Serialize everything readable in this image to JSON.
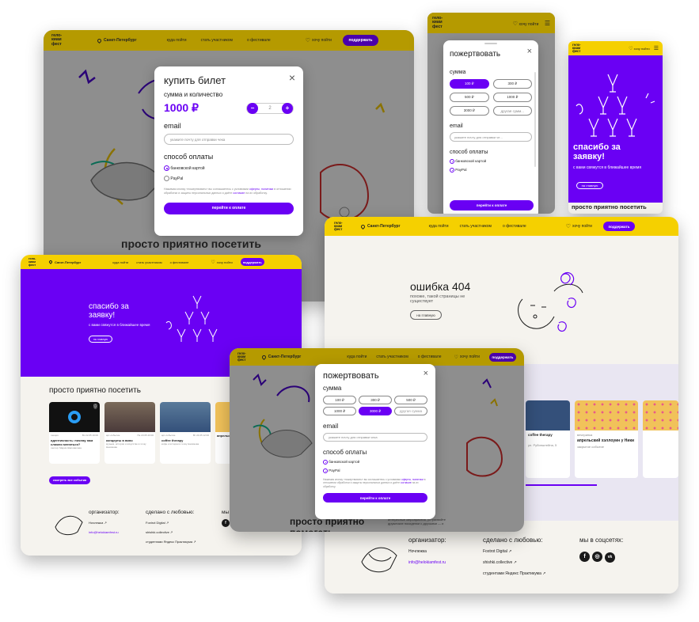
{
  "brand": {
    "logo": "гело-\nкиам\nфест",
    "city": "Санкт-Петербург"
  },
  "colors": {
    "accent": "#6a00f4",
    "brand": "#f5d000",
    "background": "#f5f3ee"
  },
  "nav": {
    "where": "куда пойти",
    "participate": "стать участником",
    "about": "о фестивале",
    "want": "хочу пойти",
    "support": "поддержать"
  },
  "ticket_modal": {
    "title": "купить билет",
    "subtitle": "сумма и количество",
    "price": "1000 ₽",
    "quantity": "2",
    "email_label": "email",
    "email_placeholder": "укажите почту для отправки чека",
    "payment_label": "способ оплаты",
    "methods": [
      "банковской картой",
      "PayPal"
    ],
    "legal_a": "Нажимая кнопку «пожертвовать» вы соглашаетесь с условиями ",
    "legal_offer": "оферты",
    "legal_b": ", ",
    "legal_policy": "политики",
    "legal_c": " в отношении обработки и защиты персональных данных и даёте ",
    "legal_consent": "согласие",
    "legal_d": " на их обработку.",
    "submit": "перейти к оплате",
    "close": "×"
  },
  "donate_modal": {
    "title": "пожертвовать",
    "subtitle": "сумма",
    "amounts": [
      "100 ₽",
      "300 ₽",
      "500 ₽",
      "1000 ₽",
      "3000 ₽"
    ],
    "other": "другая сумм...",
    "other_full": "другая сумма",
    "email_label": "email",
    "email_placeholder": "укажите почту для отправки че...",
    "email_placeholder_full": "укажите почту для отправки чека",
    "payment_label": "способ оплаты",
    "methods": [
      "банковской картой",
      "PayPal"
    ],
    "submit": "перейти к оплате",
    "close": "×"
  },
  "thanks": {
    "title": "спасибо за заявку!",
    "subtitle": "с вами свяжутся в ближайшее время",
    "button": "на главную"
  },
  "error404": {
    "title": "ошибка 404",
    "subtitle": "похоже, такой страницы не существует",
    "button": "на главную"
  },
  "section": {
    "title": "просто приятно посетить",
    "all_events": "смотреть все события",
    "title_short": "просто приятно",
    "title_short2": "помогать"
  },
  "cards": [
    {
      "tag": "лекция",
      "date": "Вс 22.05 19:00",
      "title": "идентичность: почему нам сложно меняться?",
      "desc": "лектор: Мария Шаповалова",
      "place": "«Севкабель»",
      "dist": "1 км"
    },
    {
      "tag": "арт-событие",
      "date": "Пн 23.05 20:00",
      "title": "концерты в вино",
      "desc": "музыка, история и искусство в точку Нахимова",
      "place": "Петроградская ул.",
      "dist": "2 км"
    },
    {
      "tag": "арт-событие",
      "date": "Вт 24.05 12:00",
      "title": "coffee therapy",
      "desc": "кофе и истории в точку Нахимова",
      "place": "ул. Рубинштейна, 5",
      "dist": "1 км"
    },
    {
      "tag": "вечеринка",
      "date": "",
      "title": "апрельский хэллоуин у Ники",
      "desc": "закрытое событие",
      "place": "",
      "dist": ""
    }
  ],
  "footer": {
    "organizer_label": "организатор:",
    "organizer": "Ночлежка",
    "email": "info@helokiamfest.ru",
    "made_label": "сделано с любовью:",
    "made": [
      "Foxtrot Digital",
      "shishki.collective",
      "студентами Яндекс Практикума"
    ],
    "social_label": "мы в соцсетях:",
    "social_short": "мы",
    "socials": [
      "f",
      "◎",
      "vk"
    ]
  },
  "text_fragment": "интересные мероприятия, устраивайте дружеские посиделки с друзьями — и",
  "text_fragment2": "помогать",
  "menu_icon": "☰",
  "heart_icon": "♡",
  "ext_icon": "↗"
}
